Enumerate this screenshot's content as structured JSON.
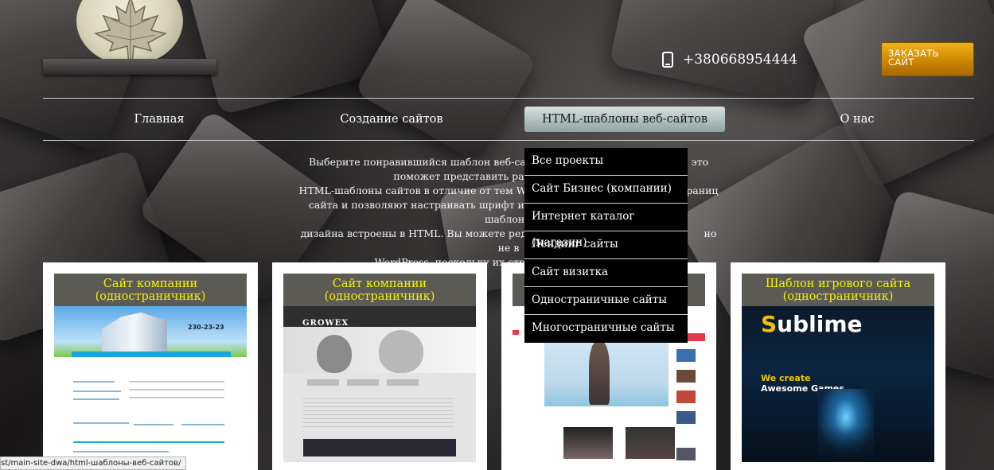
{
  "header": {
    "phone": "+380668954444",
    "order_button": "ЗАКАЗАТЬ САЙТ"
  },
  "nav": {
    "items": [
      {
        "label": "Главная"
      },
      {
        "label": "Создание сайтов"
      },
      {
        "label": "HTML-шаблоны веб-сайтов"
      },
      {
        "label": "О нас"
      }
    ],
    "active_index": 2
  },
  "intro": {
    "line1": "Выберите понравившийся  шаблон веб-сайтов",
    "line1_tail": ", это",
    "line2": "поможет представить рабо",
    "line3": "HTML-шаблоны сайтов в отличие от тем Word",
    "line3_tail": "раниц",
    "line4": "сайта и позволяют настраивать шрифт и стиль н",
    "line4_tail": "шаблоны",
    "line5": "дизайна встроены в HTML.  Вы можете редактир",
    "line5_tail": "но не в",
    "line6": "WordPress, поскольку их структур"
  },
  "dropdown": {
    "items": [
      "Все проекты",
      "Сайт Бизнес (компании)",
      "Интернет каталог (магазин)",
      "Лендинг сайты",
      "Сайт визитка",
      "Одностраничные сайты",
      "Многостраничные сайты"
    ]
  },
  "cards": [
    {
      "title": "Сайт компании (одностраничник)",
      "thumb_text": "230-23-23"
    },
    {
      "title": "Сайт компании (одностраничник)",
      "thumb_text": "GROWEX"
    },
    {
      "title": "",
      "thumb_text": ""
    },
    {
      "title": "Шаблон игрового сайта (одностраничник)",
      "thumb_brand": "Sublime",
      "thumb_tag1": "We create",
      "thumb_tag2": "Awesome Games"
    }
  ],
  "status_bar": {
    "url": "st/main-site-dwa/html-шаблоны-веб-сайтов/"
  },
  "colors": {
    "card_title_text": "#f5f200",
    "order_button": "#e0a000",
    "nav_active": "#b9c8c8"
  }
}
